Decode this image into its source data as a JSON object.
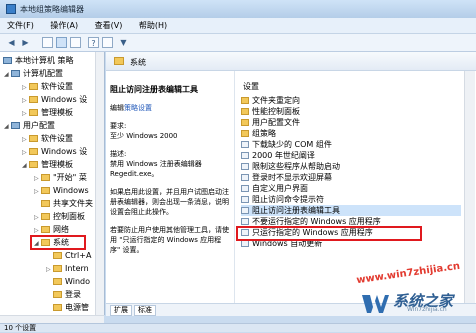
{
  "window": {
    "title": "本地组策略编辑器"
  },
  "menu": [
    "文件(F)",
    "操作(A)",
    "查看(V)",
    "帮助(H)"
  ],
  "toolbar": {
    "back": "◀",
    "forward": "▶",
    "help": "?"
  },
  "tree": {
    "root": "本地计算机 策略",
    "computer_config": "计算机配置",
    "computer_children": [
      "软件设置",
      "Windows 设",
      "管理模板"
    ],
    "user_config": "用户配置",
    "user_children": [
      "软件设置",
      "Windows 设",
      "管理模板"
    ],
    "admin_children": [
      "\"开始\" 菜",
      "Windows",
      "共享文件夹",
      "控制面板",
      "网络",
      "系统"
    ],
    "system_children": [
      "Ctrl+A",
      "Intern",
      "Windo",
      "登录",
      "电源管"
    ]
  },
  "main": {
    "header_title": "系统",
    "policy_title": "阻止访问注册表编辑工具",
    "edit_prefix": "编辑",
    "edit_link": "策略设置",
    "req_label": "要求:",
    "req_value": "至少 Windows 2000",
    "desc_label": "描述:",
    "desc_text": "禁用 Windows 注册表编辑器 Regedit.exe。",
    "desc_p2": "如果启用此设置，并且用户试图启动注册表编辑器，则会出现一条消息，说明设置会阻止此操作。",
    "desc_p3": "若要防止用户使用其他管理工具，请使用 \"只运行指定的 Windows 应用程序\" 设置。",
    "list_header": "设置",
    "items": [
      {
        "icon": "folder",
        "label": "文件夹重定向"
      },
      {
        "icon": "folder",
        "label": "性能控制面板"
      },
      {
        "icon": "folder",
        "label": "用户配置文件"
      },
      {
        "icon": "folder",
        "label": "组策略"
      },
      {
        "icon": "policy",
        "label": "下载缺少的 COM 组件"
      },
      {
        "icon": "policy",
        "label": "2000 年世纪阐译"
      },
      {
        "icon": "policy",
        "label": "限制这些程序从帮助启动"
      },
      {
        "icon": "policy",
        "label": "登录时不显示欢迎屏幕"
      },
      {
        "icon": "policy",
        "label": "自定义用户界面"
      },
      {
        "icon": "policy",
        "label": "阻止访问命令提示符"
      },
      {
        "icon": "policy",
        "label": "阻止访问注册表编辑工具",
        "selected": true
      },
      {
        "icon": "policy",
        "label": "不要运行指定的 Windows 应用程序"
      },
      {
        "icon": "policy",
        "label": "只运行指定的 Windows 应用程序"
      },
      {
        "icon": "policy",
        "label": "Windows 自动更新"
      }
    ],
    "tabs": [
      "扩展",
      "标准"
    ]
  },
  "status": {
    "text": "10 个设置"
  },
  "watermark": {
    "url": "www.win7zhijia.cn",
    "brand": "系统之家",
    "sub": "Win7zhijia.cn"
  },
  "colors": {
    "highlight": "#e0191e",
    "selection": "#cde3fa"
  }
}
